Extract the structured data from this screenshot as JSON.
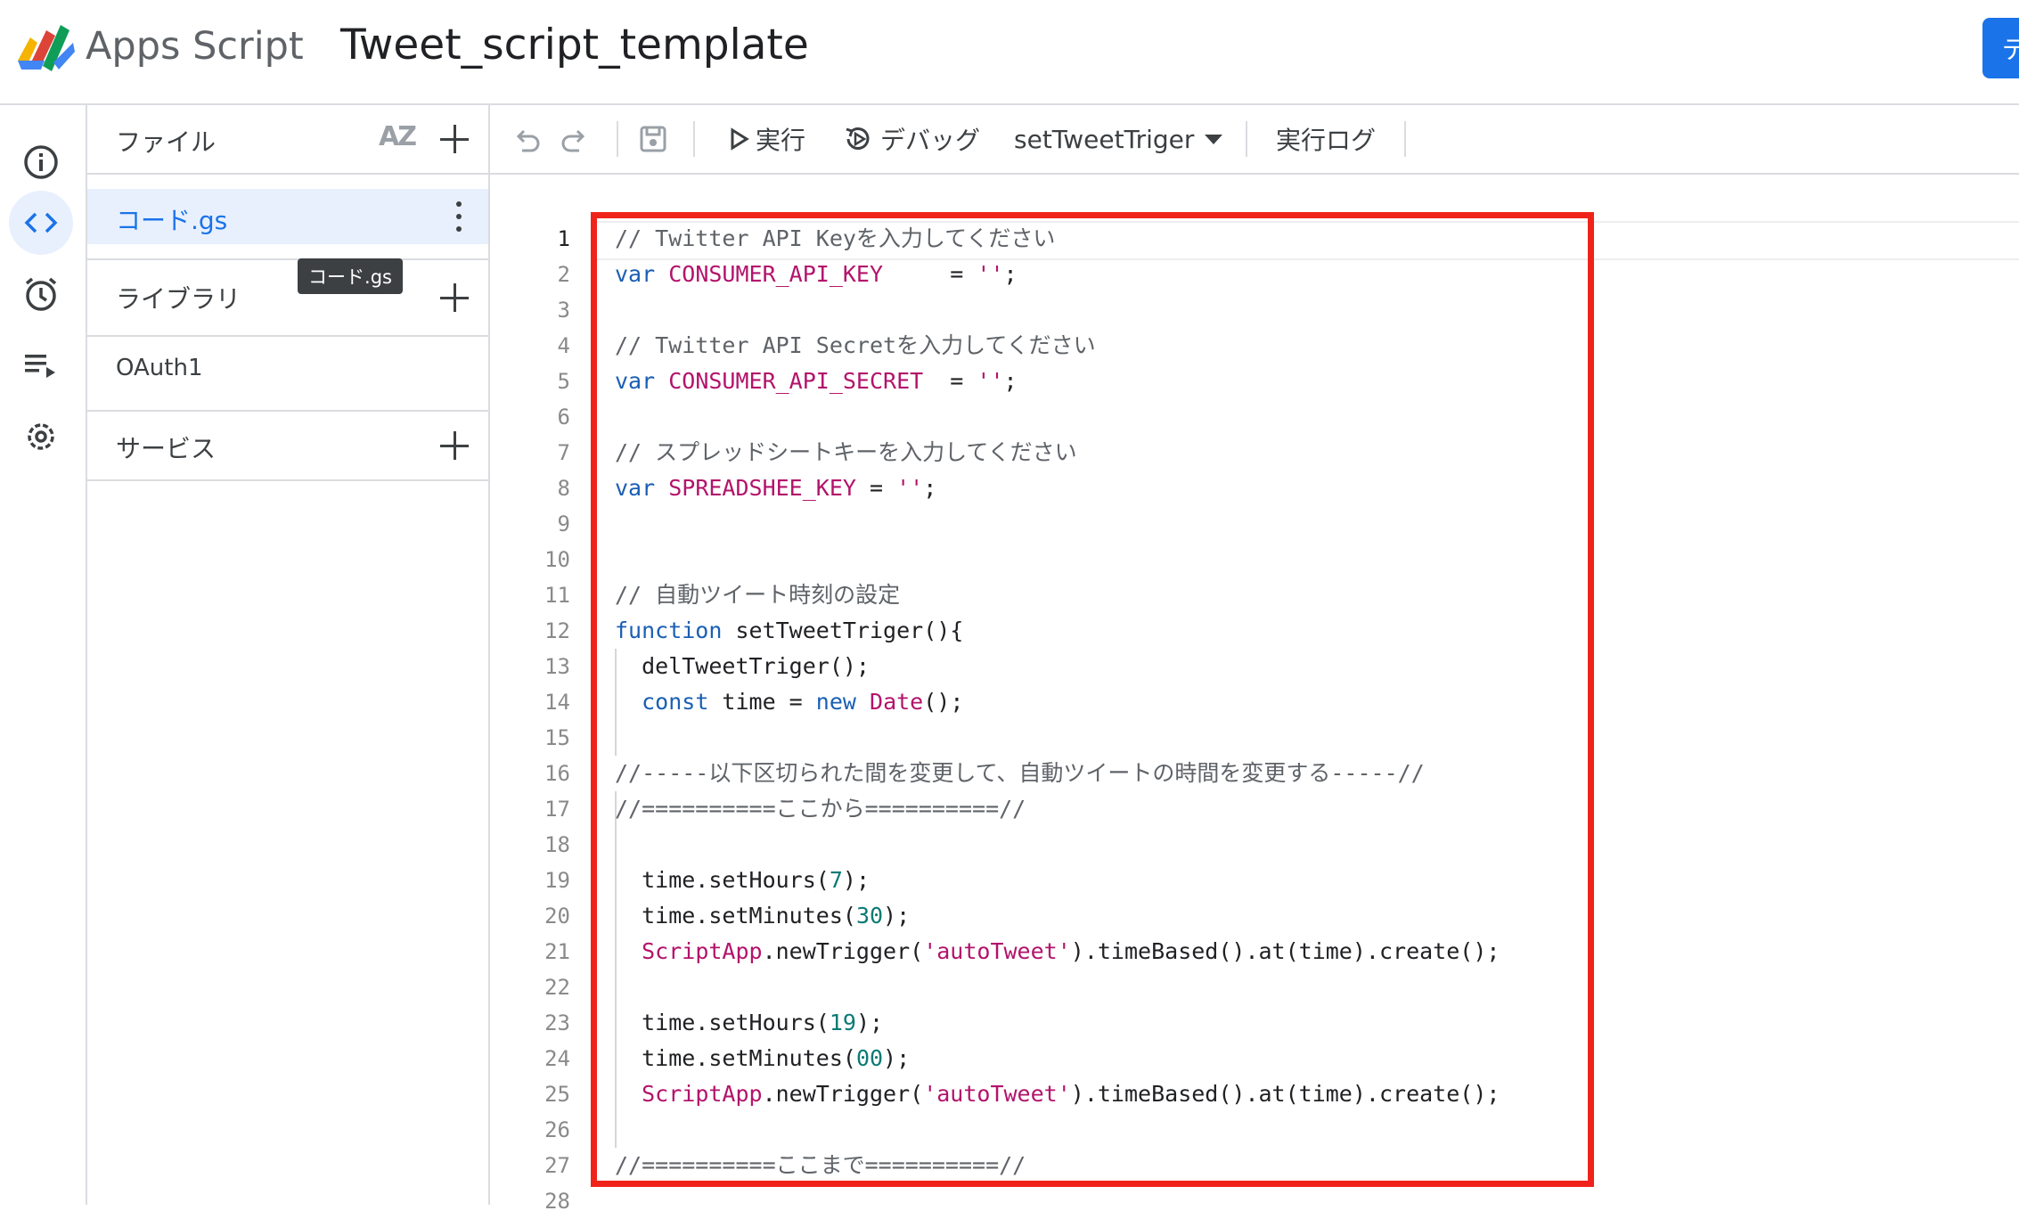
{
  "header": {
    "app_name": "Apps Script",
    "project_title": "Tweet_script_template",
    "action_button_label": "デ"
  },
  "rail": {
    "items": [
      "info-icon",
      "code-icon",
      "clock-icon",
      "executions-icon",
      "settings-icon"
    ],
    "active": "code-icon"
  },
  "files_panel": {
    "files_label": "ファイル",
    "sort_label": "AZ",
    "active_file": "コード.gs",
    "tooltip": "コード.gs",
    "libraries_label": "ライブラリ",
    "oauth_library": "OAuth1",
    "services_label": "サービス"
  },
  "toolbar": {
    "run_label": "実行",
    "debug_label": "デバッグ",
    "function_select": "setTweetTriger",
    "log_label": "実行ログ"
  },
  "editor": {
    "active_line": 1,
    "line_numbers": [
      "1",
      "2",
      "3",
      "4",
      "5",
      "6",
      "7",
      "8",
      "9",
      "10",
      "11",
      "12",
      "13",
      "14",
      "15",
      "16",
      "17",
      "18",
      "19",
      "20",
      "21",
      "22",
      "23",
      "24",
      "25",
      "26",
      "27",
      "28"
    ],
    "lines": [
      "// Twitter API Keyを入力してください",
      "var CONSUMER_API_KEY     = '';",
      "",
      "// Twitter API Secretを入力してください",
      "var CONSUMER_API_SECRET  = '';",
      "",
      "// スプレッドシートキーを入力してください",
      "var SPREADSHEE_KEY = '';",
      "",
      "",
      "// 自動ツイート時刻の設定",
      "function setTweetTriger(){",
      "  delTweetTriger();",
      "  const time = new Date();",
      "",
      "//-----以下区切られた間を変更して、自動ツイートの時間を変更する-----//",
      "//==========ここから==========//",
      "",
      "  time.setHours(7);",
      "  time.setMinutes(30);",
      "  ScriptApp.newTrigger('autoTweet').timeBased().at(time).create();",
      "",
      "  time.setHours(19);",
      "  time.setMinutes(00);",
      "  ScriptApp.newTrigger('autoTweet').timeBased().at(time).create();",
      "",
      "//==========ここまで==========//",
      ""
    ]
  },
  "colors": {
    "highlight_box": "#f0231b",
    "accent": "#1a73e8",
    "active_row": "#e8f0fe"
  }
}
